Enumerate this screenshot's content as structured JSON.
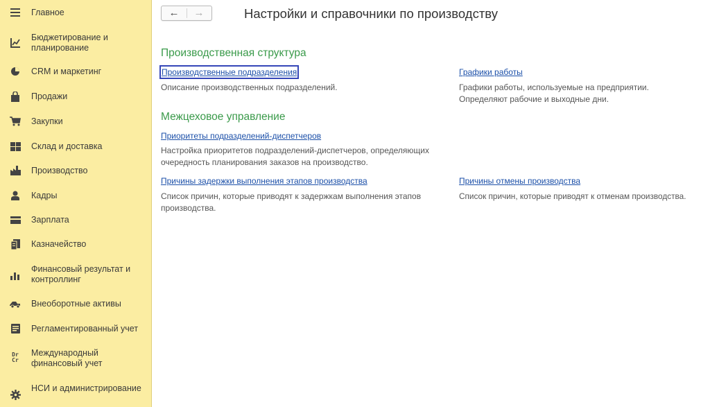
{
  "sidebar": {
    "items": [
      {
        "label": "Главное",
        "icon": "menu-lines-icon"
      },
      {
        "label": "Бюджетирование и планирование",
        "icon": "budget-chart-icon"
      },
      {
        "label": "CRM и маркетинг",
        "icon": "crm-pie-icon"
      },
      {
        "label": "Продажи",
        "icon": "shopping-bag-icon"
      },
      {
        "label": "Закупки",
        "icon": "shopping-cart-icon"
      },
      {
        "label": "Склад и доставка",
        "icon": "warehouse-icon"
      },
      {
        "label": "Производство",
        "icon": "factory-icon"
      },
      {
        "label": "Кадры",
        "icon": "person-icon"
      },
      {
        "label": "Зарплата",
        "icon": "wallet-card-icon"
      },
      {
        "label": "Казначейство",
        "icon": "treasury-icon"
      },
      {
        "label": "Финансовый результат и контроллинг",
        "icon": "bar-chart-icon"
      },
      {
        "label": "Внеоборотные активы",
        "icon": "truck-icon"
      },
      {
        "label": "Регламентированный учет",
        "icon": "document-icon"
      },
      {
        "label": "Международный финансовый учет",
        "icon": "dr-cr-icon",
        "icon_text": "Dr\nCr"
      },
      {
        "label": "НСИ и администрирование",
        "icon": "gear-icon"
      }
    ]
  },
  "header": {
    "back_glyph": "←",
    "forward_glyph": "→",
    "title": "Настройки и справочники по производству"
  },
  "sections": [
    {
      "title": "Производственная структура",
      "entries": [
        {
          "link": "Производственные подразделения",
          "desc": "Описание производственных подразделений.",
          "selected": true
        },
        {
          "link": "Графики работы",
          "desc": "Графики работы, используемые на предприятии. Определяют рабочие и выходные дни."
        }
      ]
    },
    {
      "title": "Межцеховое управление",
      "entries": [
        {
          "link": "Приоритеты подразделений-диспетчеров",
          "desc": "Настройка приоритетов подразделений-диспетчеров, определяющих очередность планирования заказов на производство."
        },
        {
          "link": "Причины задержки выполнения этапов производства",
          "desc": "Список причин, которые приводят к задержкам выполнения этапов производства."
        },
        {
          "link": "Причины отмены производства",
          "desc": "Список причин, которые приводят к отменам производства."
        }
      ]
    }
  ],
  "colors": {
    "sidebar_bg": "#fbeda2",
    "section_title": "#3a9a4a",
    "link": "#1b4fa8",
    "selection_outline": "#3546b8"
  }
}
